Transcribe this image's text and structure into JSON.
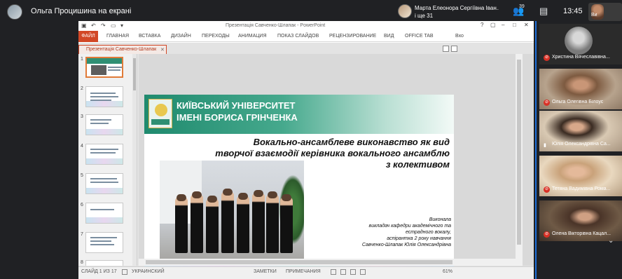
{
  "meeting": {
    "presenter_title": "Ольга Процишина на екрані",
    "speaker_name": "Марта Елеонора Сергіївна Іван...",
    "speaker_more": "і ще 31",
    "participants_count": "39",
    "clock": "13:45",
    "self_label": "Ви"
  },
  "ppt": {
    "window_title": "Презентація Савченко-Шлапак - PowerPoint",
    "ribbon_tabs": [
      "ФАЙЛ",
      "ГЛАВНАЯ",
      "ВСТАВКА",
      "ДИЗАЙН",
      "ПЕРЕХОДЫ",
      "АНИМАЦИЯ",
      "ПОКАЗ СЛАЙДОВ",
      "РЕЦЕНЗИРОВАНИЕ",
      "ВИД",
      "OFFICE TAB"
    ],
    "ribbon_right": "Вхо",
    "doc_tab": "Презентація Савченко-Шлапак",
    "thumb_numbers": [
      "1",
      "2",
      "3",
      "4",
      "5",
      "6",
      "7",
      "8"
    ],
    "status": {
      "slide": "СЛАЙД 1 ИЗ 17",
      "lang": "УКРАИНСКИЙ",
      "notes": "ЗАМЕТКИ",
      "comments": "ПРИМЕЧАНИЯ",
      "zoom": "61%"
    }
  },
  "slide": {
    "uni_line1": "КИЇВСЬКИЙ УНІВЕРСИТЕТ",
    "uni_line2": "ІМЕНІ БОРИСА ГРІНЧЕНКА",
    "title": "Вокально-ансамблеве виконавство як вид творчої взаємодії керівника вокального ансамблю з колективом",
    "credits": [
      "Виконала",
      "викладач кафедри академічного та",
      "естрадного вокалу,",
      "аспірантка 2 року навчання",
      "Савченко-Шлапак Юлія Олександрівна"
    ]
  },
  "participants": [
    {
      "name": "Христина Вячеславівна...",
      "muted": true
    },
    {
      "name": "Ольга Олегівна Білоус",
      "muted": true
    },
    {
      "name": "Юлія Олександрівна Са...",
      "muted": false
    },
    {
      "name": "Тетяна Вадимівна Рома...",
      "muted": true
    },
    {
      "name": "Олена Вікторівна Кацал...",
      "muted": true
    }
  ],
  "colors": {
    "ppt_accent": "#d24726",
    "slide_green": "#1f8a6e",
    "mute_red": "#d93025",
    "share_stripe": "#1e6fd9"
  }
}
